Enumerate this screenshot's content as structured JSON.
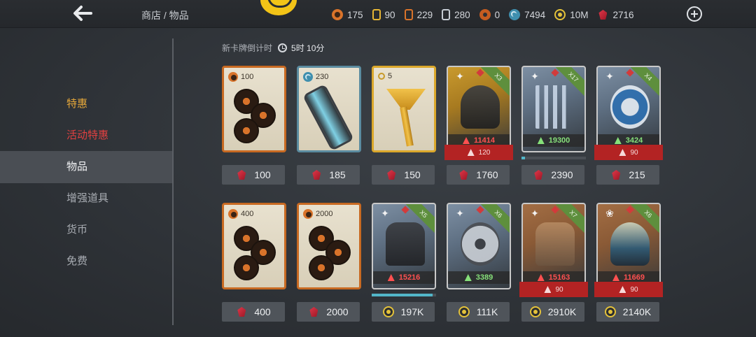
{
  "header": {
    "breadcrumb": "商店 / 物品",
    "currencies": [
      {
        "icon": "orange-coin-icon",
        "value": "175"
      },
      {
        "icon": "gold-key-card-icon",
        "value": "90"
      },
      {
        "icon": "orange-card-icon",
        "value": "229"
      },
      {
        "icon": "silver-card-icon",
        "value": "280"
      },
      {
        "icon": "radiation-icon",
        "value": "0"
      },
      {
        "icon": "swirl-icon",
        "value": "7494"
      },
      {
        "icon": "gold-coin-icon",
        "value": "10M"
      },
      {
        "icon": "ruby-gem-icon",
        "value": "2716"
      }
    ]
  },
  "sidebar": {
    "items": [
      {
        "label": "特惠"
      },
      {
        "label": "活动特惠"
      },
      {
        "label": "物品"
      },
      {
        "label": "增强道具"
      },
      {
        "label": "货币"
      },
      {
        "label": "免费"
      }
    ]
  },
  "countdown": {
    "label": "新卡牌倒计时",
    "time": "5时 10分"
  },
  "row1": [
    {
      "qty": "100",
      "price": "100",
      "currency": "gem"
    },
    {
      "qty": "230",
      "price": "185",
      "currency": "gem"
    },
    {
      "qty": "5",
      "price": "150",
      "currency": "gem"
    },
    {
      "count": "X3",
      "power": "11414",
      "power_color": "red",
      "req": "120",
      "price": "1760",
      "currency": "gem"
    },
    {
      "count": "X17",
      "power": "19300",
      "power_color": "green",
      "progress": 0.05,
      "price": "2390",
      "currency": "gem"
    },
    {
      "count": "X4",
      "power": "3424",
      "power_color": "green",
      "req": "90",
      "price": "215",
      "currency": "gem"
    }
  ],
  "row2": [
    {
      "qty": "400",
      "price": "400",
      "currency": "gem"
    },
    {
      "qty": "2000",
      "price": "2000",
      "currency": "gem"
    },
    {
      "count": "X5",
      "power": "15216",
      "power_color": "red",
      "progress": 0.95,
      "price": "197K",
      "currency": "coin"
    },
    {
      "count": "X6",
      "power": "3389",
      "power_color": "green",
      "price": "111K",
      "currency": "coin"
    },
    {
      "count": "X7",
      "power": "15163",
      "power_color": "red",
      "req": "90",
      "price": "2910K",
      "currency": "coin"
    },
    {
      "count": "X6",
      "power": "11669",
      "power_color": "red",
      "req": "90",
      "price": "2140K",
      "currency": "coin"
    }
  ],
  "colors": {
    "accent_red": "#b32323",
    "gold": "#f3c417",
    "progress": "#52b6c9"
  }
}
